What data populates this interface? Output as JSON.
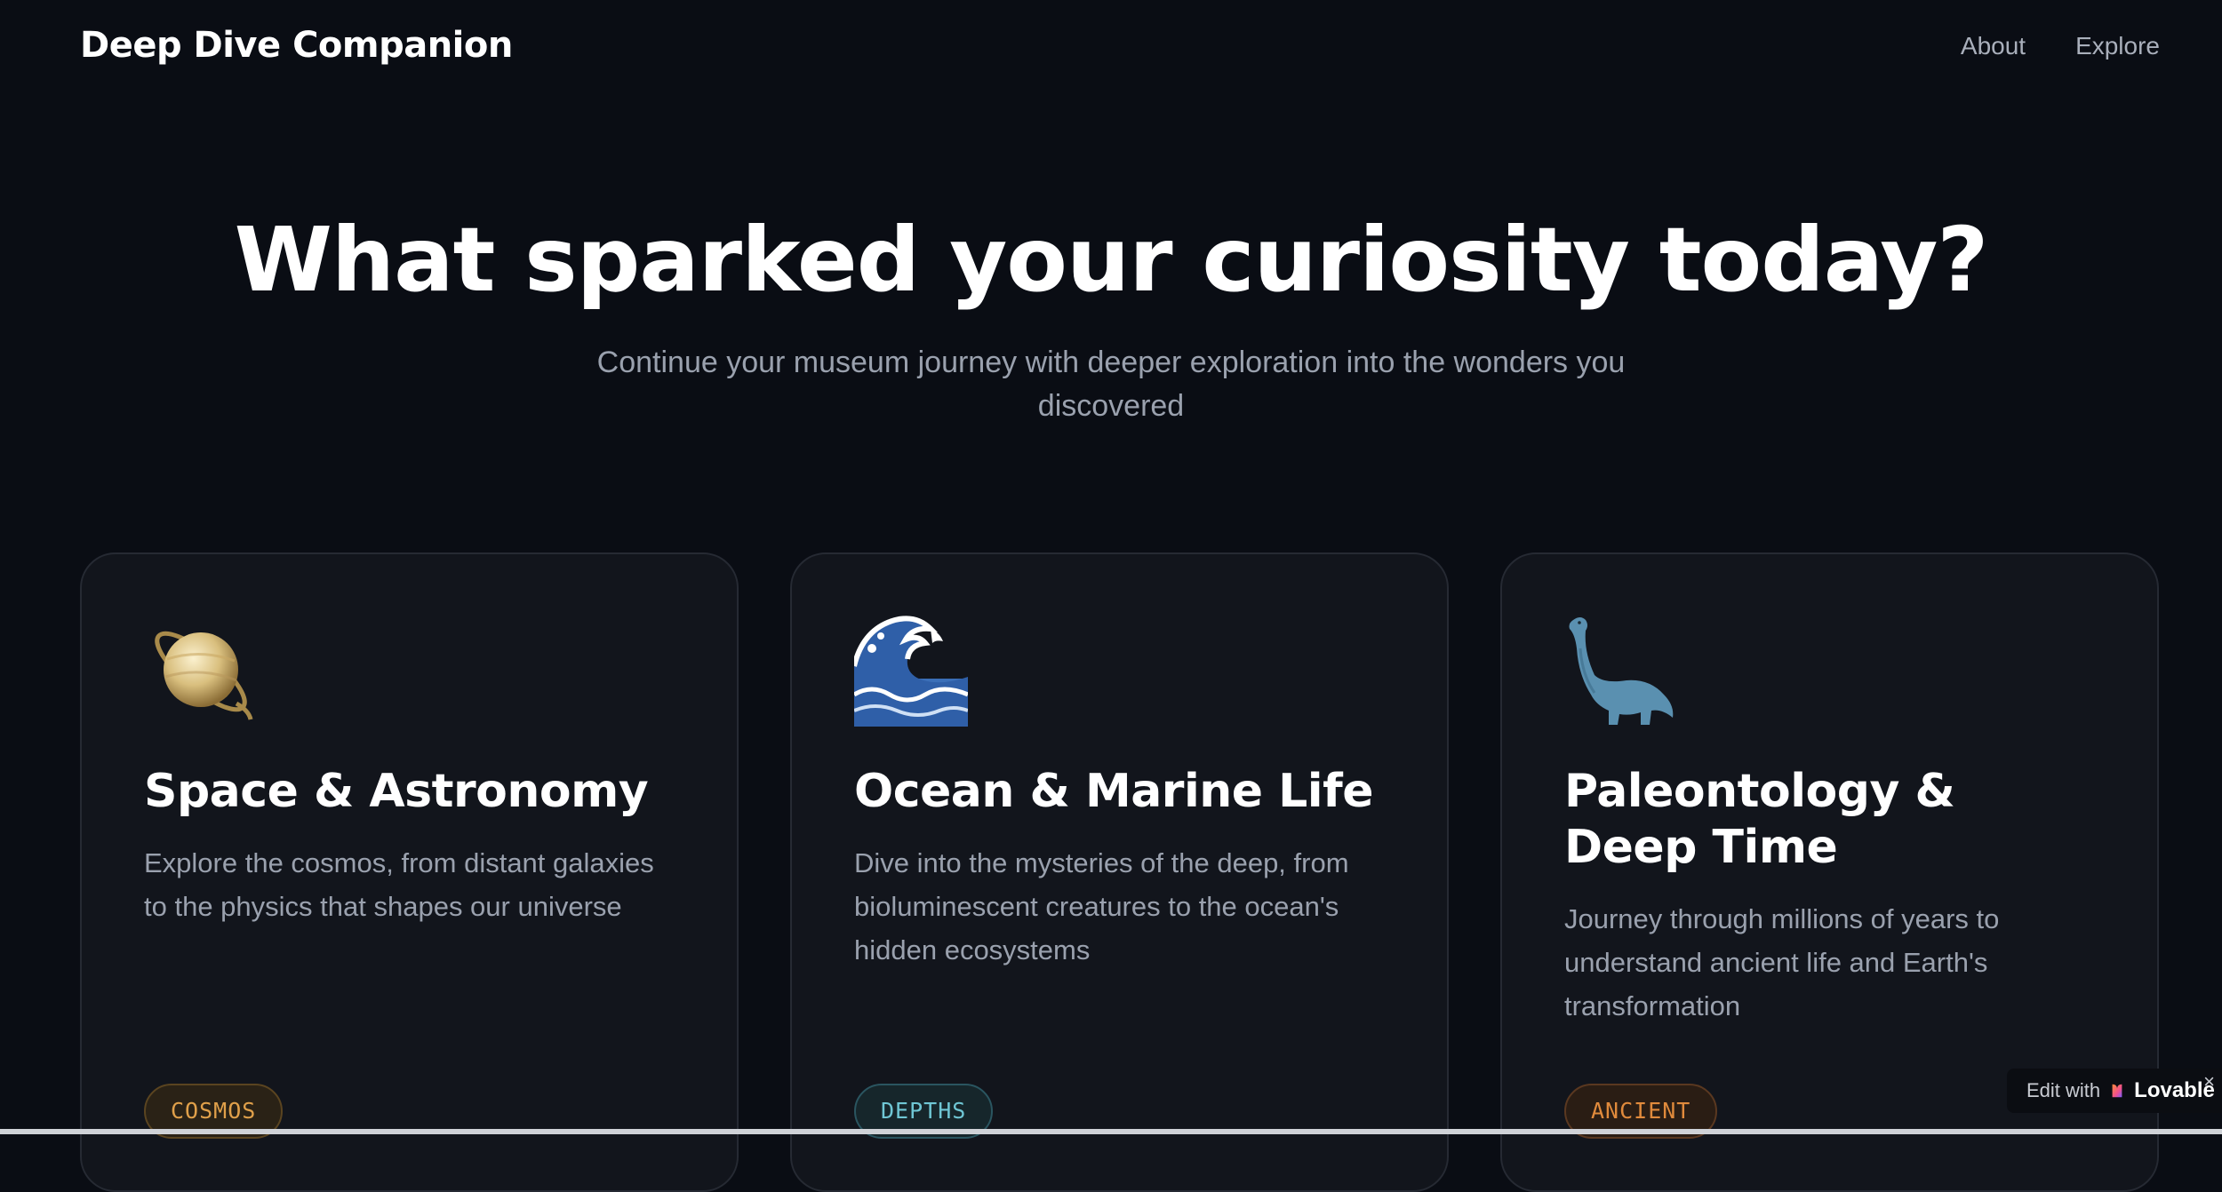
{
  "header": {
    "brand": "Deep Dive Companion",
    "nav": [
      {
        "label": "About"
      },
      {
        "label": "Explore"
      }
    ]
  },
  "hero": {
    "title": "What sparked your curiosity today?",
    "subtitle": "Continue your museum journey with deeper exploration into the wonders you discovered"
  },
  "cards": [
    {
      "icon": "saturn-icon",
      "title": "Space & Astronomy",
      "description": "Explore the cosmos, from distant galaxies to the physics that shapes our universe",
      "tag": "COSMOS"
    },
    {
      "icon": "wave-icon",
      "title": "Ocean & Marine Life",
      "description": "Dive into the mysteries of the deep, from bioluminescent creatures to the ocean's hidden ecosystems",
      "tag": "DEPTHS"
    },
    {
      "icon": "dinosaur-icon",
      "title": "Paleontology & Deep Time",
      "description": "Journey through millions of years to understand ancient life and Earth's transformation",
      "tag": "ANCIENT"
    }
  ],
  "badge": {
    "prefix": "Edit with",
    "brand": "Lovable",
    "close": "×"
  },
  "colors": {
    "background": "#0a0d14",
    "card": "#12151c",
    "cosmos": "#e0a04a",
    "depths": "#6fc6d4",
    "ancient": "#e08a3c"
  }
}
